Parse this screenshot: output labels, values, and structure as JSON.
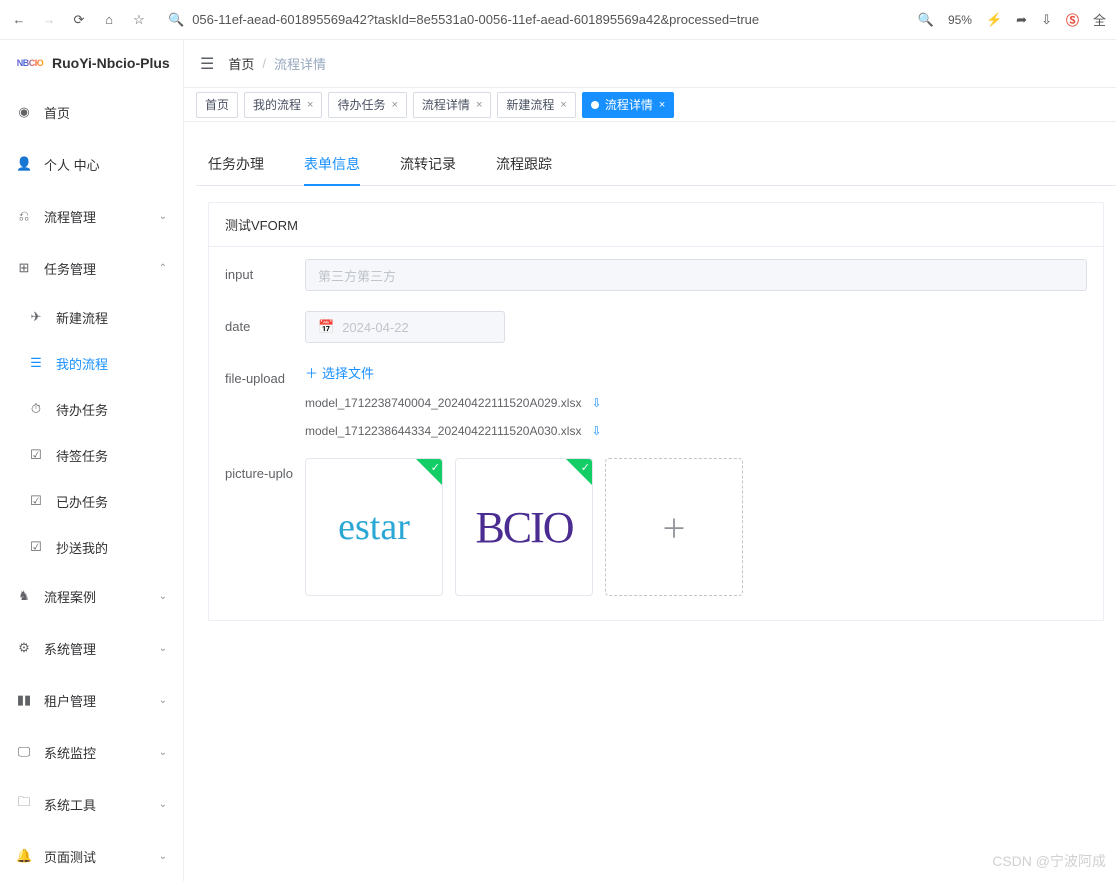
{
  "browser": {
    "url": "056-11ef-aead-601895569a42?taskId=8e5531a0-0056-11ef-aead-601895569a42&processed=true",
    "zoom": "95%"
  },
  "app_name": "RuoYi-Nbcio-Plus",
  "breadcrumb": {
    "home": "首页",
    "current": "流程详情"
  },
  "sidebar": {
    "items": [
      {
        "icon": "dashboard",
        "label": "首页",
        "expandable": false
      },
      {
        "icon": "user",
        "label": "个人 中心",
        "expandable": false
      },
      {
        "icon": "flow",
        "label": "流程管理",
        "expandable": true,
        "open": false
      },
      {
        "icon": "task",
        "label": "任务管理",
        "expandable": true,
        "open": true
      },
      {
        "icon": "case",
        "label": "流程案例",
        "expandable": true,
        "open": false
      },
      {
        "icon": "gear",
        "label": "系统管理",
        "expandable": true,
        "open": false
      },
      {
        "icon": "tenant",
        "label": "租户管理",
        "expandable": true,
        "open": false
      },
      {
        "icon": "monitor",
        "label": "系统监控",
        "expandable": true,
        "open": false
      },
      {
        "icon": "tool",
        "label": "系统工具",
        "expandable": true,
        "open": false
      },
      {
        "icon": "bell",
        "label": "页面测试",
        "expandable": true,
        "open": false
      }
    ],
    "task_children": [
      {
        "icon": "send",
        "label": "新建流程"
      },
      {
        "icon": "list",
        "label": "我的流程",
        "active": true
      },
      {
        "icon": "clock",
        "label": "待办任务"
      },
      {
        "icon": "check",
        "label": "待签任务"
      },
      {
        "icon": "check",
        "label": "已办任务"
      },
      {
        "icon": "check",
        "label": "抄送我的"
      }
    ]
  },
  "tabs": [
    {
      "label": "首页",
      "closable": false
    },
    {
      "label": "我的流程",
      "closable": true
    },
    {
      "label": "待办任务",
      "closable": true
    },
    {
      "label": "流程详情",
      "closable": true
    },
    {
      "label": "新建流程",
      "closable": true
    },
    {
      "label": "流程详情",
      "closable": true,
      "active": true
    }
  ],
  "inner_tabs": [
    {
      "label": "任务办理"
    },
    {
      "label": "表单信息",
      "active": true
    },
    {
      "label": "流转记录"
    },
    {
      "label": "流程跟踪"
    }
  ],
  "form": {
    "title": "测试VFORM",
    "input_label": "input",
    "input_value": "第三方第三方",
    "date_label": "date",
    "date_value": "2024-04-22",
    "file_label": "file-upload",
    "file_btn": "选择文件",
    "files": [
      "model_1712238740004_20240422111520A029.xlsx",
      "model_1712238644334_20240422111520A030.xlsx"
    ],
    "pic_label": "picture-uplo",
    "pics": [
      "estar",
      "BCIO"
    ]
  },
  "watermark": "CSDN @宁波阿成",
  "icons": {
    "plus": "+",
    "download": "⇩",
    "calendar": "📅",
    "close": "×",
    "chevron_down": "⌄",
    "chevron_up": "⌃"
  }
}
